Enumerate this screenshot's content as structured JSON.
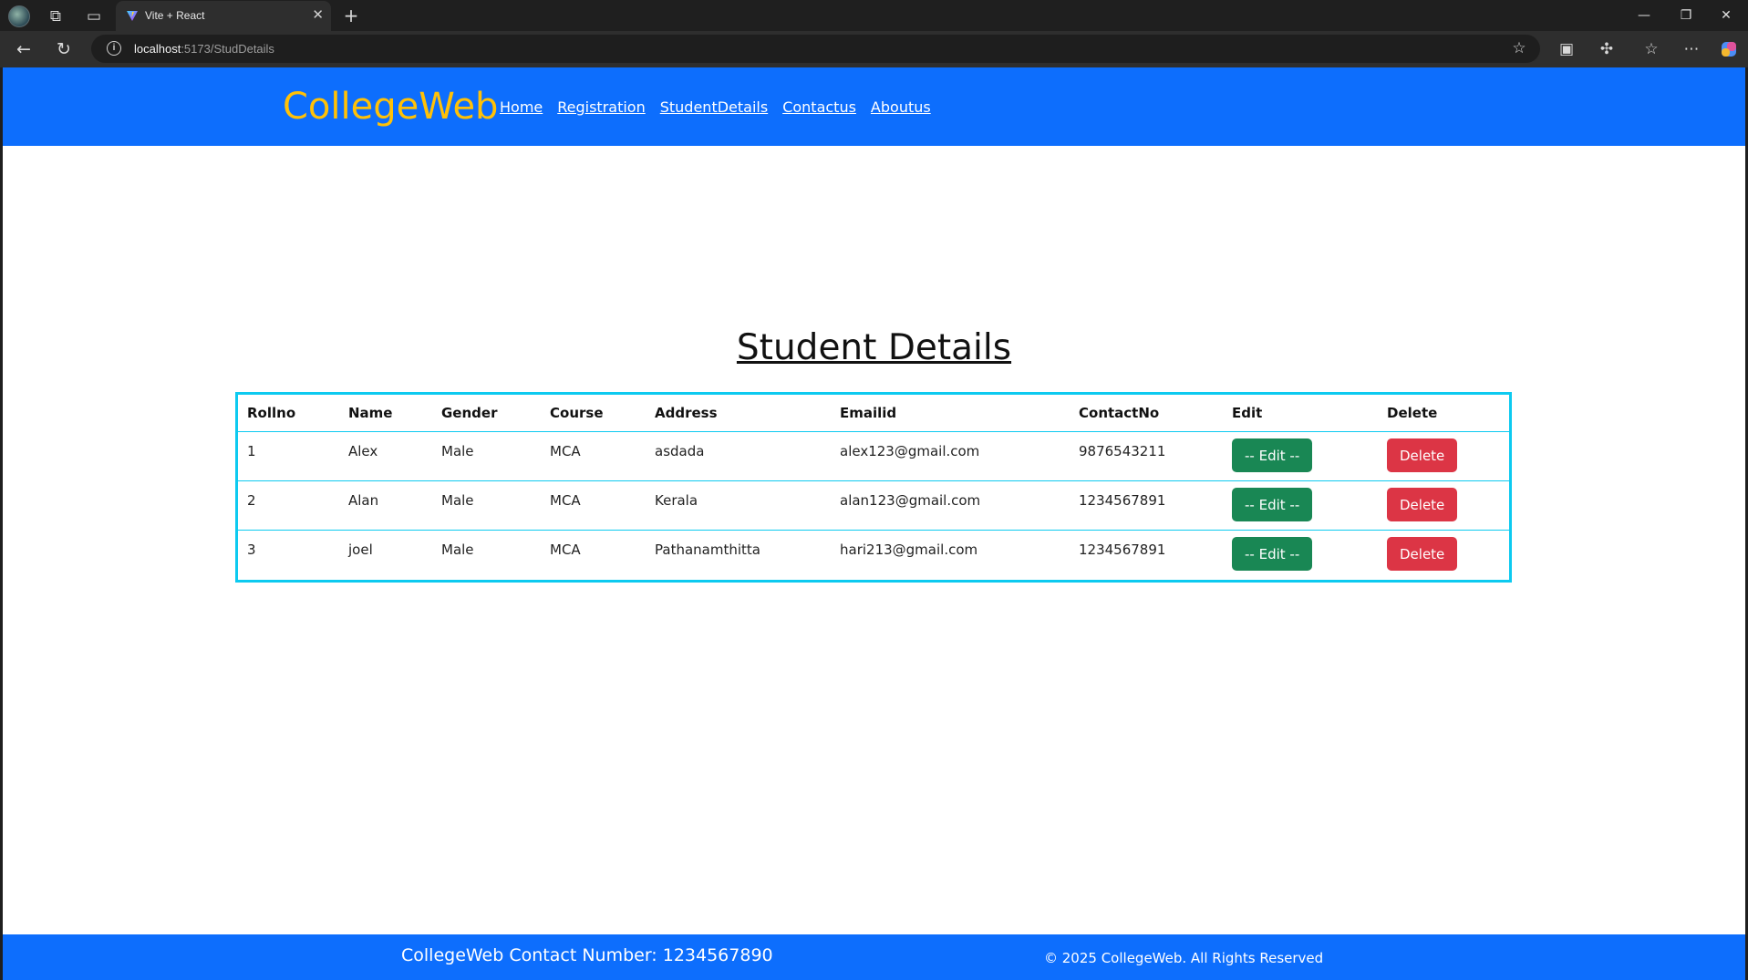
{
  "browser": {
    "tab_title": "Vite + React",
    "url_host": "localhost",
    "url_path": ":5173/StudDetails"
  },
  "navbar": {
    "brand": "CollegeWeb",
    "brand_color": "#ffc107",
    "background": "#0d6efd",
    "links": [
      "Home",
      "Registration",
      "StudentDetails",
      "Contactus",
      "Aboutus"
    ]
  },
  "main": {
    "title": "Student Details",
    "table": {
      "headers": [
        "Rollno",
        "Name",
        "Gender",
        "Course",
        "Address",
        "Emailid",
        "ContactNo",
        "Edit",
        "Delete"
      ],
      "rows": [
        {
          "rollno": "1",
          "name": "Alex",
          "gender": "Male",
          "course": "MCA",
          "address": "asdada",
          "email": "alex123@gmail.com",
          "contact": "9876543211"
        },
        {
          "rollno": "2",
          "name": "Alan",
          "gender": "Male",
          "course": "MCA",
          "address": "Kerala",
          "email": "alan123@gmail.com",
          "contact": "1234567891"
        },
        {
          "rollno": "3",
          "name": "joel",
          "gender": "Male",
          "course": "MCA",
          "address": "Pathanamthitta",
          "email": "hari213@gmail.com",
          "contact": "1234567891"
        }
      ],
      "edit_label": "-- Edit --",
      "delete_label": "Delete"
    }
  },
  "footer": {
    "contact": "CollegeWeb Contact Number: 1234567890",
    "copyright": "© 2025 CollegeWeb. All Rights Reserved"
  },
  "colors": {
    "edit_button": "#198754",
    "delete_button": "#dc3545",
    "table_border": "#0dcaf0"
  }
}
